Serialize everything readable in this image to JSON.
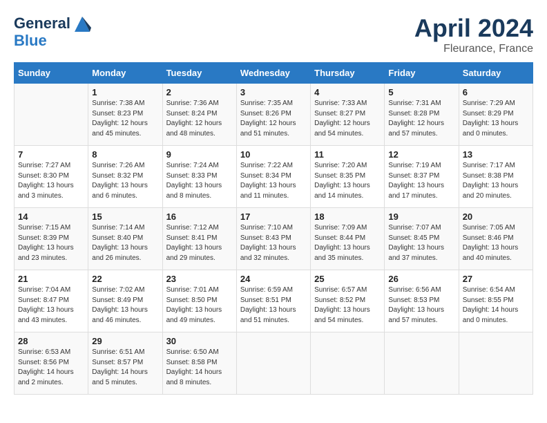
{
  "header": {
    "logo_line1": "General",
    "logo_line2": "Blue",
    "month": "April 2024",
    "location": "Fleurance, France"
  },
  "weekdays": [
    "Sunday",
    "Monday",
    "Tuesday",
    "Wednesday",
    "Thursday",
    "Friday",
    "Saturday"
  ],
  "weeks": [
    [
      {
        "day": "",
        "text": ""
      },
      {
        "day": "1",
        "text": "Sunrise: 7:38 AM\nSunset: 8:23 PM\nDaylight: 12 hours\nand 45 minutes."
      },
      {
        "day": "2",
        "text": "Sunrise: 7:36 AM\nSunset: 8:24 PM\nDaylight: 12 hours\nand 48 minutes."
      },
      {
        "day": "3",
        "text": "Sunrise: 7:35 AM\nSunset: 8:26 PM\nDaylight: 12 hours\nand 51 minutes."
      },
      {
        "day": "4",
        "text": "Sunrise: 7:33 AM\nSunset: 8:27 PM\nDaylight: 12 hours\nand 54 minutes."
      },
      {
        "day": "5",
        "text": "Sunrise: 7:31 AM\nSunset: 8:28 PM\nDaylight: 12 hours\nand 57 minutes."
      },
      {
        "day": "6",
        "text": "Sunrise: 7:29 AM\nSunset: 8:29 PM\nDaylight: 13 hours\nand 0 minutes."
      }
    ],
    [
      {
        "day": "7",
        "text": "Sunrise: 7:27 AM\nSunset: 8:30 PM\nDaylight: 13 hours\nand 3 minutes."
      },
      {
        "day": "8",
        "text": "Sunrise: 7:26 AM\nSunset: 8:32 PM\nDaylight: 13 hours\nand 6 minutes."
      },
      {
        "day": "9",
        "text": "Sunrise: 7:24 AM\nSunset: 8:33 PM\nDaylight: 13 hours\nand 8 minutes."
      },
      {
        "day": "10",
        "text": "Sunrise: 7:22 AM\nSunset: 8:34 PM\nDaylight: 13 hours\nand 11 minutes."
      },
      {
        "day": "11",
        "text": "Sunrise: 7:20 AM\nSunset: 8:35 PM\nDaylight: 13 hours\nand 14 minutes."
      },
      {
        "day": "12",
        "text": "Sunrise: 7:19 AM\nSunset: 8:37 PM\nDaylight: 13 hours\nand 17 minutes."
      },
      {
        "day": "13",
        "text": "Sunrise: 7:17 AM\nSunset: 8:38 PM\nDaylight: 13 hours\nand 20 minutes."
      }
    ],
    [
      {
        "day": "14",
        "text": "Sunrise: 7:15 AM\nSunset: 8:39 PM\nDaylight: 13 hours\nand 23 minutes."
      },
      {
        "day": "15",
        "text": "Sunrise: 7:14 AM\nSunset: 8:40 PM\nDaylight: 13 hours\nand 26 minutes."
      },
      {
        "day": "16",
        "text": "Sunrise: 7:12 AM\nSunset: 8:41 PM\nDaylight: 13 hours\nand 29 minutes."
      },
      {
        "day": "17",
        "text": "Sunrise: 7:10 AM\nSunset: 8:43 PM\nDaylight: 13 hours\nand 32 minutes."
      },
      {
        "day": "18",
        "text": "Sunrise: 7:09 AM\nSunset: 8:44 PM\nDaylight: 13 hours\nand 35 minutes."
      },
      {
        "day": "19",
        "text": "Sunrise: 7:07 AM\nSunset: 8:45 PM\nDaylight: 13 hours\nand 37 minutes."
      },
      {
        "day": "20",
        "text": "Sunrise: 7:05 AM\nSunset: 8:46 PM\nDaylight: 13 hours\nand 40 minutes."
      }
    ],
    [
      {
        "day": "21",
        "text": "Sunrise: 7:04 AM\nSunset: 8:47 PM\nDaylight: 13 hours\nand 43 minutes."
      },
      {
        "day": "22",
        "text": "Sunrise: 7:02 AM\nSunset: 8:49 PM\nDaylight: 13 hours\nand 46 minutes."
      },
      {
        "day": "23",
        "text": "Sunrise: 7:01 AM\nSunset: 8:50 PM\nDaylight: 13 hours\nand 49 minutes."
      },
      {
        "day": "24",
        "text": "Sunrise: 6:59 AM\nSunset: 8:51 PM\nDaylight: 13 hours\nand 51 minutes."
      },
      {
        "day": "25",
        "text": "Sunrise: 6:57 AM\nSunset: 8:52 PM\nDaylight: 13 hours\nand 54 minutes."
      },
      {
        "day": "26",
        "text": "Sunrise: 6:56 AM\nSunset: 8:53 PM\nDaylight: 13 hours\nand 57 minutes."
      },
      {
        "day": "27",
        "text": "Sunrise: 6:54 AM\nSunset: 8:55 PM\nDaylight: 14 hours\nand 0 minutes."
      }
    ],
    [
      {
        "day": "28",
        "text": "Sunrise: 6:53 AM\nSunset: 8:56 PM\nDaylight: 14 hours\nand 2 minutes."
      },
      {
        "day": "29",
        "text": "Sunrise: 6:51 AM\nSunset: 8:57 PM\nDaylight: 14 hours\nand 5 minutes."
      },
      {
        "day": "30",
        "text": "Sunrise: 6:50 AM\nSunset: 8:58 PM\nDaylight: 14 hours\nand 8 minutes."
      },
      {
        "day": "",
        "text": ""
      },
      {
        "day": "",
        "text": ""
      },
      {
        "day": "",
        "text": ""
      },
      {
        "day": "",
        "text": ""
      }
    ]
  ]
}
